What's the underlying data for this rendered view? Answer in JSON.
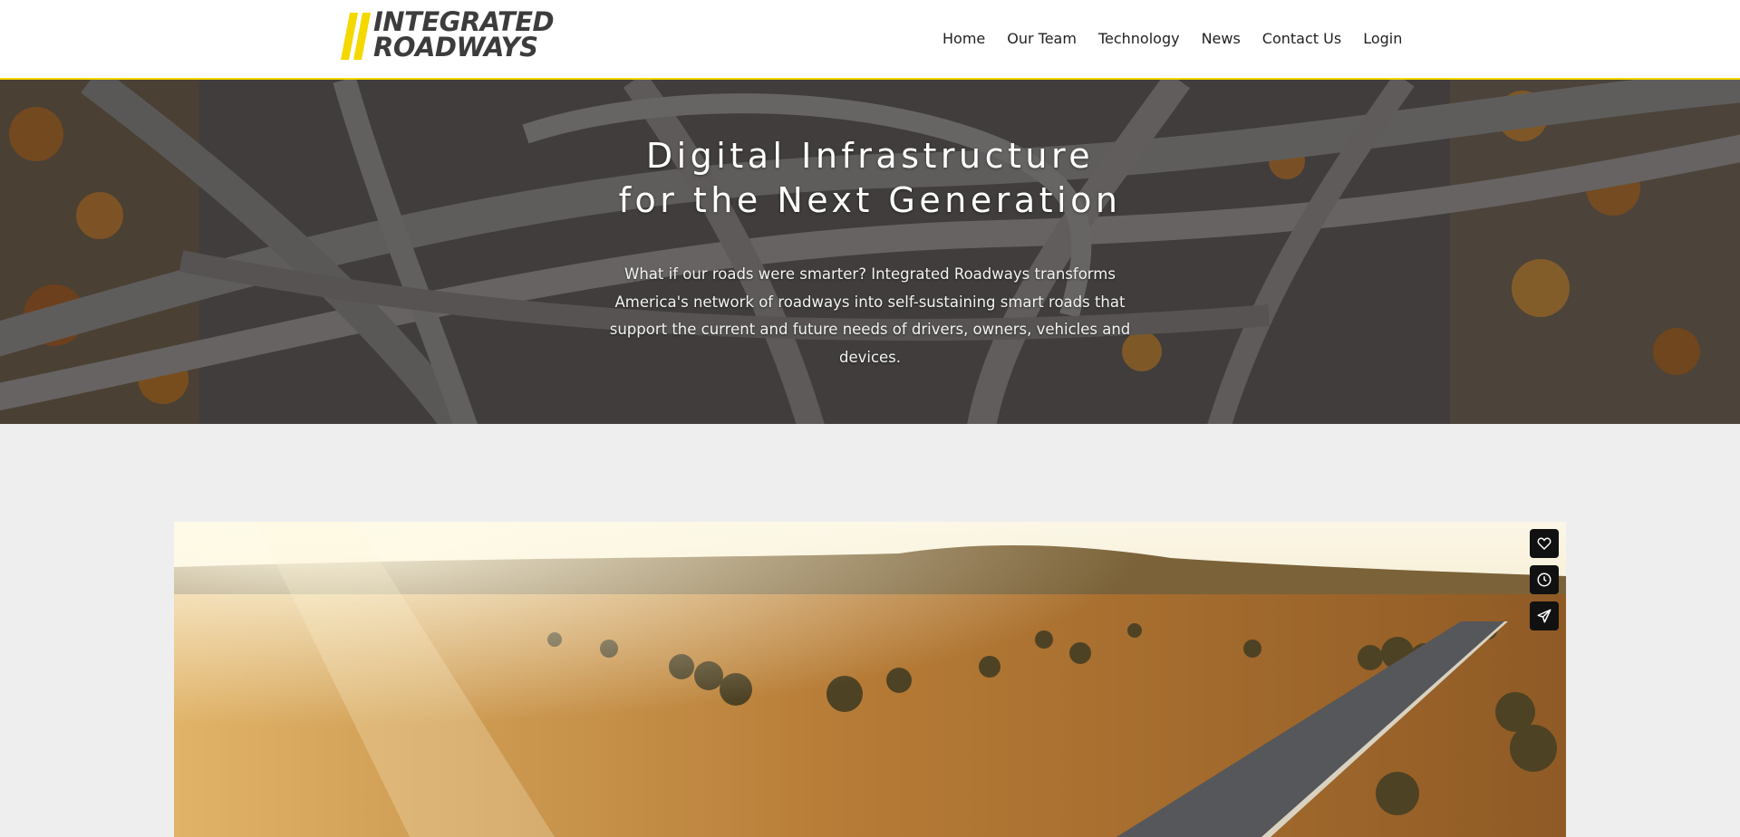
{
  "brand": {
    "line1": "INTEGRATED",
    "line2": "ROADWAYS",
    "accent": "#f5d800"
  },
  "nav": {
    "items": [
      "Home",
      "Our Team",
      "Technology",
      "News",
      "Contact Us",
      "Login"
    ]
  },
  "hero": {
    "title_line1": "Digital Infrastructure",
    "title_line2": "for the Next Generation",
    "subtitle": "What if our roads were smarter? Integrated Roadways transforms America's network of roadways into self-sustaining smart roads that support the current and future needs of drivers, owners, vehicles and devices."
  },
  "video": {
    "actions": [
      {
        "icon": "heart-icon"
      },
      {
        "icon": "clock-icon"
      },
      {
        "icon": "send-icon"
      }
    ]
  }
}
